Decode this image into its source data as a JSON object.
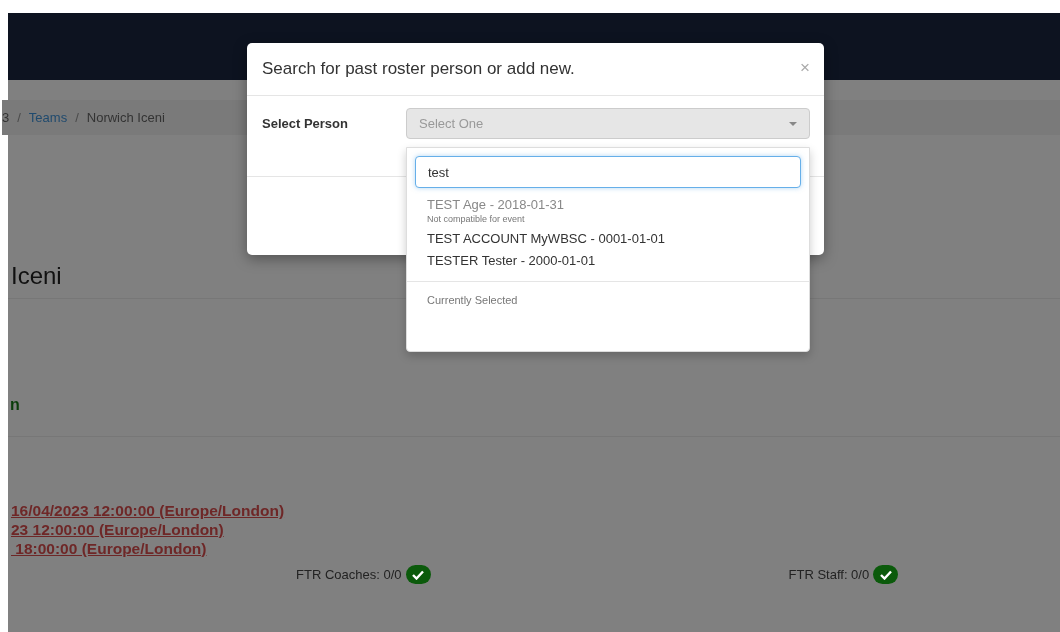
{
  "breadcrumb": [
    {
      "label": "3",
      "kind": "text"
    },
    {
      "label": "/",
      "kind": "separator"
    },
    {
      "label": "Teams",
      "kind": "link"
    },
    {
      "label": "/",
      "kind": "separator"
    },
    {
      "label": "Norwich Iceni",
      "kind": "text"
    }
  ],
  "page_title": "Iceni",
  "status_text": "n",
  "deadlines": [
    "16/04/2023 12:00:00 (Europe/London)",
    "23 12:00:00 (Europe/London)",
    " 18:00:00 (Europe/London)"
  ],
  "counts": [
    {
      "label": "FTR Coaches: 0/0",
      "ok": true
    },
    {
      "label": "FTR Staff: 0/0",
      "ok": true
    }
  ],
  "modal": {
    "title": "Search for past roster person or add new.",
    "close": "×",
    "field_label": "Select Person",
    "select_placeholder": "Select One",
    "dropdown": {
      "search_value": "test",
      "options": [
        {
          "label": "TEST Age - 2018-01-31",
          "note": "Not compatible for event",
          "disabled": true
        },
        {
          "label": "TEST ACCOUNT MyWBSC - 0001-01-01",
          "disabled": false
        },
        {
          "label": "TESTER Tester - 2000-01-01",
          "disabled": false
        }
      ],
      "section": "Currently Selected"
    }
  }
}
